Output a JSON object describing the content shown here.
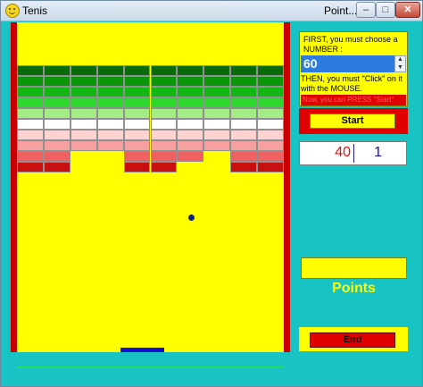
{
  "window": {
    "title": "Tenis",
    "title_right": "Point...",
    "min_glyph": "–",
    "max_glyph": "□",
    "close_glyph": "✕",
    "background_color": "#18c3c3",
    "app_icon": "smiley-icon"
  },
  "game": {
    "field_color": "#ffff00",
    "wall_color": "#c80000",
    "ball_color": "#10208a",
    "paddle_color": "#1010c8",
    "brick_columns": 10,
    "brick_rows": [
      {
        "color": "#0a6b0a",
        "present": [
          1,
          1,
          1,
          1,
          1,
          1,
          1,
          1,
          1,
          1
        ]
      },
      {
        "color": "#0c960c",
        "present": [
          1,
          1,
          1,
          1,
          1,
          1,
          1,
          1,
          1,
          1
        ]
      },
      {
        "color": "#13b713",
        "present": [
          1,
          1,
          1,
          1,
          1,
          1,
          1,
          1,
          1,
          1
        ]
      },
      {
        "color": "#2fd82f",
        "present": [
          1,
          1,
          1,
          1,
          1,
          1,
          1,
          1,
          1,
          1
        ]
      },
      {
        "color": "#a4ec84",
        "present": [
          1,
          1,
          1,
          1,
          1,
          1,
          1,
          1,
          1,
          1
        ]
      },
      {
        "color": "#ffffff",
        "present": [
          1,
          1,
          1,
          1,
          1,
          1,
          1,
          1,
          1,
          1
        ]
      },
      {
        "color": "#ffd2d2",
        "present": [
          1,
          1,
          1,
          1,
          1,
          1,
          1,
          1,
          1,
          1
        ]
      },
      {
        "color": "#f7a0a0",
        "present": [
          1,
          1,
          1,
          1,
          1,
          1,
          1,
          1,
          1,
          1
        ]
      },
      {
        "color": "#ef6060",
        "present": [
          1,
          1,
          0,
          0,
          1,
          1,
          1,
          0,
          1,
          1
        ]
      },
      {
        "color": "#c81010",
        "present": [
          1,
          1,
          0,
          0,
          1,
          1,
          0,
          0,
          1,
          1
        ]
      }
    ]
  },
  "panel": {
    "instruction_1": "FIRST, you must choose a NUMBER :",
    "number_value": "60",
    "spin_up": "▲",
    "spin_down": "▼",
    "instruction_2": "THEN, you must \"Click\" on it with the MOUSE.",
    "instruction_3": "Now, you can PRESS \"Start\"",
    "start_label": "Start",
    "value_left": "40",
    "value_right": "1",
    "points_label": "Points",
    "end_label": "End"
  }
}
